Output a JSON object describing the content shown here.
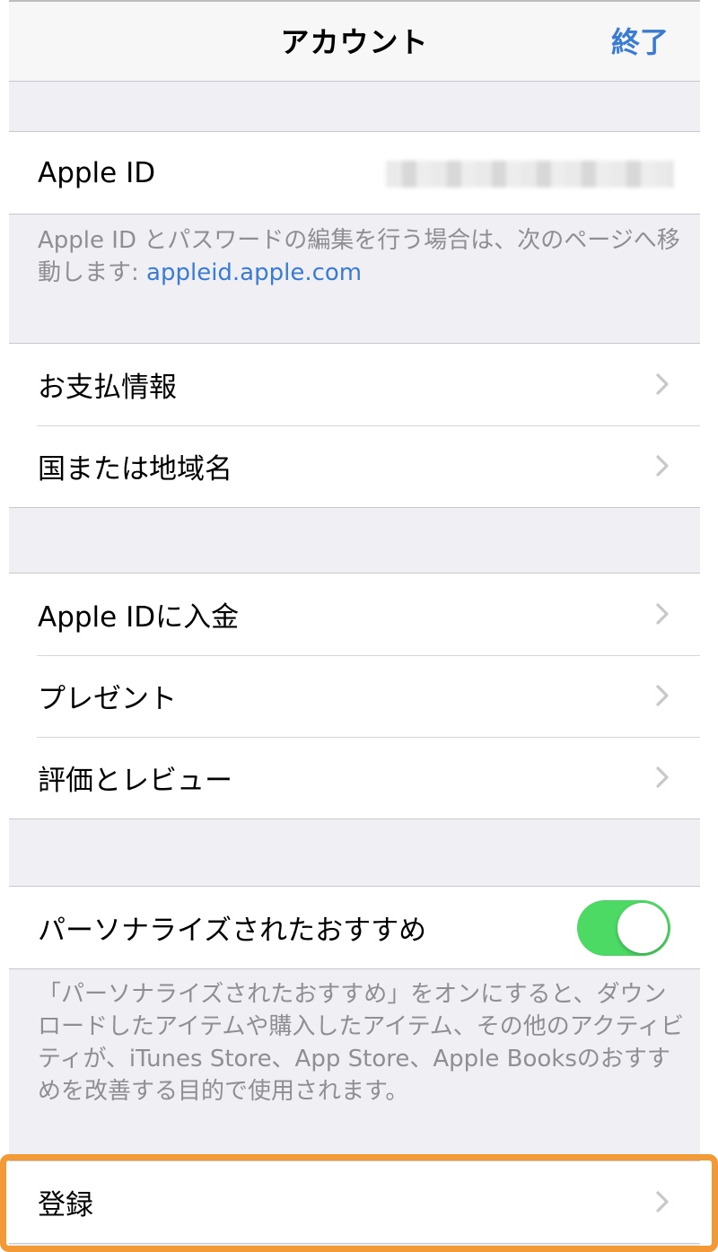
{
  "navbar": {
    "title": "アカウント",
    "done_label": "終了"
  },
  "apple_id_group": {
    "label": "Apple ID"
  },
  "apple_id_footnote": {
    "text": "Apple ID とパスワードの編集を行う場合は、次のページへ移動します: ",
    "link": "appleid.apple.com"
  },
  "group2": {
    "items": [
      {
        "label": "お支払情報"
      },
      {
        "label": "国または地域名"
      }
    ]
  },
  "group3": {
    "items": [
      {
        "label": "Apple IDに入金"
      },
      {
        "label": "プレゼント"
      },
      {
        "label": "評価とレビュー"
      }
    ]
  },
  "personalize": {
    "label": "パーソナライズされたおすすめ",
    "toggle_on": true,
    "toggle_color": "#4cd964"
  },
  "personalize_footnote": {
    "text": "「パーソナライズされたおすすめ」をオンにすると、ダウンロードしたアイテムや購入したアイテム、その他のアクティビティが、iTunes Store、App Store、Apple Booksのおすすめを改善する目的で使用されます。"
  },
  "register": {
    "label": "登録",
    "highlight_color": "#f39a36"
  },
  "colors": {
    "accent": "#3a7bd5"
  }
}
